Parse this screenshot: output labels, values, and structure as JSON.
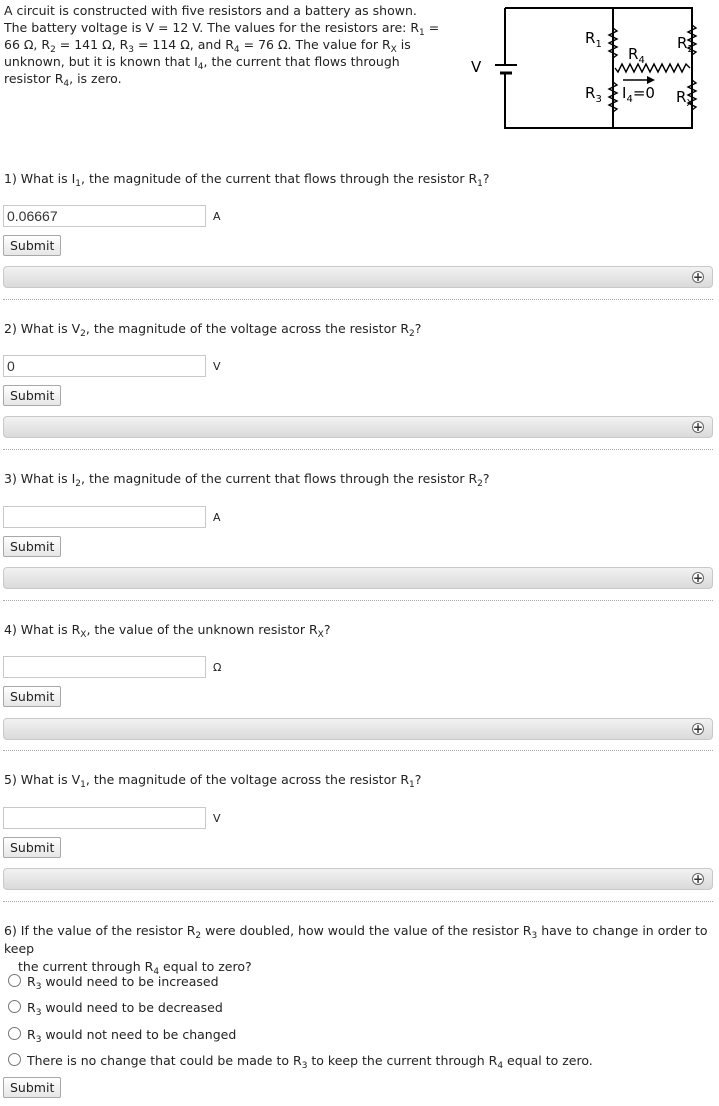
{
  "intro": {
    "s1": "A circuit is constructed with five resistors and a battery as shown. The battery voltage is V = 12 V. The values for the resistors are: R",
    "s2": " = 66 Ω, R",
    "s3": " = 141 Ω, R",
    "s4": " = 114 Ω, and R",
    "s5": " = 76 Ω. The value for R",
    "s6": " is unknown, but it is known that I",
    "s7": ", the current that flows through resistor R",
    "s8": ", is zero."
  },
  "subs": {
    "one": "1",
    "two": "2",
    "three": "3",
    "four": "4",
    "x": "X"
  },
  "circuit": {
    "v_label": "V",
    "r1": "R",
    "r2": "R",
    "r3": "R",
    "r4": "R",
    "rx": "R",
    "i4": "I",
    "i4_eq": "=0"
  },
  "questions": {
    "q1": {
      "pre": "1) What is I",
      "mid": ", the magnitude of the current that flows through the resistor R",
      "post": "?",
      "value": "0.06667",
      "unit": "A"
    },
    "q2": {
      "pre": "2) What is V",
      "mid": ", the magnitude of the voltage across the resistor R",
      "post": "?",
      "value": "0",
      "unit": "V"
    },
    "q3": {
      "pre": "3) What is I",
      "mid": ", the magnitude of the current that flows through the resistor R",
      "post": "?",
      "value": "",
      "unit": "A"
    },
    "q4": {
      "pre": "4) What is R",
      "mid": ", the value of the unknown resistor R",
      "post": "?",
      "value": "",
      "unit": "Ω"
    },
    "q5": {
      "pre": "5) What is V",
      "mid": ", the magnitude of the voltage across the resistor R",
      "post": "?",
      "value": "",
      "unit": "V"
    }
  },
  "submit_label": "Submit",
  "expand_icon": "plus-circle-icon",
  "q6": {
    "a": "6) If the value of the resistor R",
    "b": " were doubled, how would the value of the resistor R",
    "c": " have to change in order to keep",
    "d": "the current through R",
    "e": " equal to zero?",
    "options": [
      {
        "pre": "R",
        "post": " would need to be increased"
      },
      {
        "pre": "R",
        "post": " would need to be decreased"
      },
      {
        "pre": "R",
        "post": " would not need to be changed"
      },
      {
        "pre": "There is no change that could be made to R",
        "mid": " to keep the current through R",
        "post": " equal to zero."
      }
    ]
  }
}
